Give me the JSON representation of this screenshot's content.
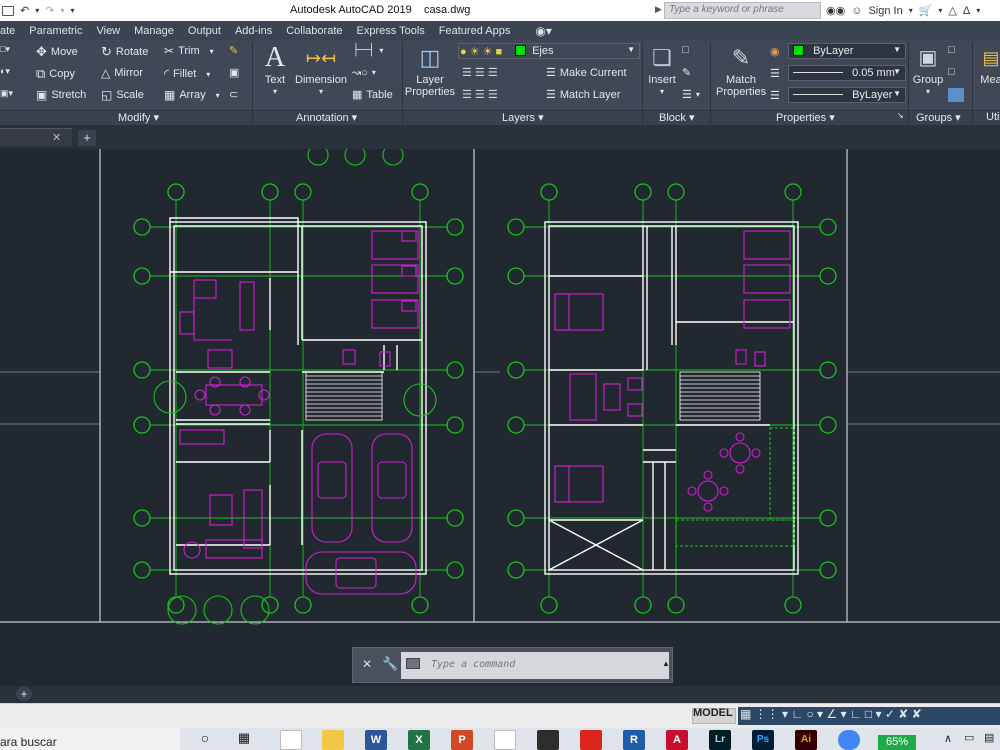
{
  "window": {
    "app_title": "Autodesk AutoCAD 2019",
    "filename": "casa.dwg"
  },
  "search": {
    "placeholder": "Type a keyword or phrase"
  },
  "account": {
    "sign_in": "Sign In"
  },
  "menu": {
    "items": [
      "ate",
      "Parametric",
      "View",
      "Manage",
      "Output",
      "Add-ins",
      "Collaborate",
      "Express Tools",
      "Featured Apps"
    ]
  },
  "modify": {
    "title": "Modify",
    "move": "Move",
    "rotate": "Rotate",
    "trim": "Trim",
    "copy": "Copy",
    "mirror": "Mirror",
    "fillet": "Fillet",
    "stretch": "Stretch",
    "scale": "Scale",
    "array": "Array"
  },
  "annotation": {
    "title": "Annotation",
    "text": "Text",
    "dimension": "Dimension",
    "table": "Table"
  },
  "layers": {
    "title": "Layers",
    "layer_properties": "Layer\nProperties",
    "current_layer": "Ejes",
    "make_current": "Make Current",
    "match_layer": "Match Layer"
  },
  "block": {
    "title": "Block",
    "insert": "Insert"
  },
  "properties": {
    "title": "Properties",
    "match_properties": "Match\nProperties",
    "color": "ByLayer",
    "lineweight": "0.05 mm",
    "linetype": "ByLayer"
  },
  "groups": {
    "title": "Groups",
    "group": "Group"
  },
  "utilities": {
    "title": "Uti",
    "measure": "Mea"
  },
  "command": {
    "placeholder": "Type a command"
  },
  "status": {
    "model": "MODEL"
  },
  "taskbar": {
    "search_text": "ara buscar",
    "battery": "65%"
  },
  "colors": {
    "ribbon": "#404857",
    "canvas": "#212830",
    "grid_green": "#16c41c",
    "furniture_magenta": "#d21fd4",
    "walls": "#ffffff"
  }
}
